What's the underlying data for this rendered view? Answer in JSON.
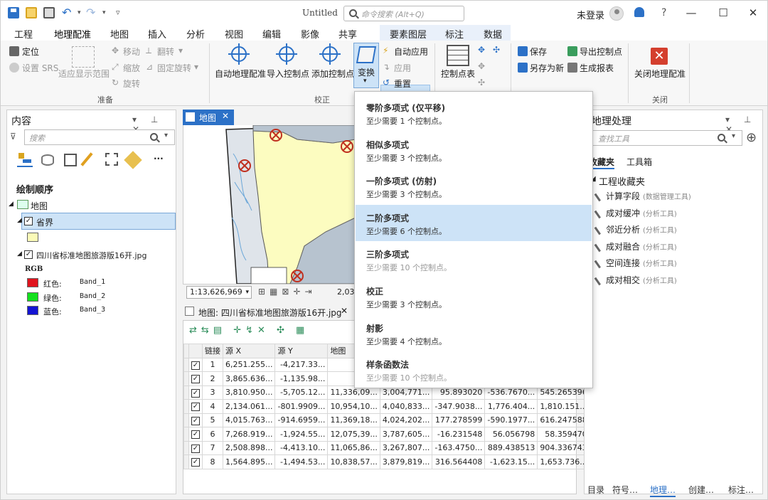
{
  "window": {
    "title": "Untitled",
    "command_search_placeholder": "命令搜索 (Alt+Q)",
    "login": "未登录",
    "help": "?",
    "controls": [
      "—",
      "☐",
      "✕"
    ]
  },
  "ribbon_tabs": [
    "工程",
    "地理配准",
    "地图",
    "插入",
    "分析",
    "视图",
    "编辑",
    "影像",
    "共享",
    "要素图层",
    "标注",
    "数据"
  ],
  "ribbon": {
    "prepare": {
      "locate": "定位",
      "move": "移动",
      "flip": "翻转",
      "set_srs": "设置 SRS",
      "fit_display": "适应显示范围",
      "scale": "缩放",
      "fixed_rotate": "固定旋转",
      "rotate": "旋转",
      "group_label": "准备"
    },
    "correct": {
      "auto_georef": "自动地理配准",
      "import_cp": "导入控制点",
      "add_cp": "添加控制点",
      "transform": "变换",
      "auto_apply": "自动应用",
      "apply": "应用",
      "reset": "重置",
      "group_label": "校正"
    },
    "cp_table": "控制点表",
    "save": {
      "save": "保存",
      "save_as_new": "另存为新",
      "export_cp": "导出控制点",
      "gen_report": "生成报表"
    },
    "close": {
      "close_georef": "关闭地理配准",
      "group_label": "关闭"
    }
  },
  "contents": {
    "title": "内容",
    "search_placeholder": "搜索",
    "draw_order": "绘制顺序",
    "map_node": "地图",
    "layer1": "省界",
    "layer2": "四川省标准地图旅游版16开.jpg",
    "rgb": "RGB",
    "bands": [
      {
        "label": "红色:",
        "band": "Band_1",
        "color": "#e0141e"
      },
      {
        "label": "绿色:",
        "band": "Band_2",
        "color": "#14e01e"
      },
      {
        "label": "蓝色:",
        "band": "Band_3",
        "color": "#1414d2"
      }
    ],
    "layer1_fill": "#fbfbb8"
  },
  "map": {
    "tab_label": "地图",
    "scale": "1:13,626,969",
    "coord_fragment": "2,03"
  },
  "table": {
    "tab_label": "地图: 四川省标准地图旅游版16开.jpg",
    "columns": [
      "链接",
      "源 X",
      "源 Y",
      "地图",
      "",
      "",
      "",
      ""
    ],
    "rows": [
      [
        "1",
        "6,251.255...",
        "-4,217.33...",
        "11,84",
        "",
        "",
        "",
        ""
      ],
      [
        "2",
        "3,865.636...",
        "-1,135.98...",
        "11,33",
        "",
        "",
        "",
        ""
      ],
      [
        "3",
        "3,810.950...",
        "-5,705.12...",
        "11,336,09...",
        "3,004,771...",
        "95.893020",
        "-536.7670...",
        "545.265396"
      ],
      [
        "4",
        "2,134.061...",
        "-801.9909...",
        "10,954,10...",
        "4,040,833...",
        "-347.9038...",
        "1,776.404...",
        "1,810.151..."
      ],
      [
        "5",
        "4,015.763...",
        "-914.6959...",
        "11,369,18...",
        "4,024,202...",
        "177.278599",
        "-590.1977...",
        "616.247588"
      ],
      [
        "6",
        "7,268.919...",
        "-1,924.55...",
        "12,075,39...",
        "3,787,605...",
        "-16.231548",
        "56.056798",
        "58.359470"
      ],
      [
        "7",
        "2,508.898...",
        "-4,413.10...",
        "11,065,86...",
        "3,267,807...",
        "-163.4750...",
        "889.438513",
        "904.336743"
      ],
      [
        "8",
        "1,564.895...",
        "-1,494.53...",
        "10,838,57...",
        "3,879,819...",
        "316.564408",
        "-1,623.15...",
        "1,653.736..."
      ]
    ]
  },
  "transform_menu": [
    {
      "title": "零阶多项式 (仅平移)",
      "desc": "至少需要 1 个控制点。",
      "enabled": true,
      "selected": false
    },
    {
      "title": "相似多项式",
      "desc": "至少需要 3 个控制点。",
      "enabled": true,
      "selected": false
    },
    {
      "title": "一阶多项式 (仿射)",
      "desc": "至少需要 3 个控制点。",
      "enabled": true,
      "selected": false
    },
    {
      "title": "二阶多项式",
      "desc": "至少需要 6 个控制点。",
      "enabled": true,
      "selected": true
    },
    {
      "title": "三阶多项式",
      "desc": "至少需要 10 个控制点。",
      "enabled": false,
      "selected": false
    },
    {
      "title": "校正",
      "desc": "至少需要 3 个控制点。",
      "enabled": true,
      "selected": false
    },
    {
      "title": "射影",
      "desc": "至少需要 4 个控制点。",
      "enabled": true,
      "selected": false
    },
    {
      "title": "样条函数法",
      "desc": "至少需要 10 个控制点。",
      "enabled": false,
      "selected": false
    }
  ],
  "geoprocessing": {
    "title": "地理处理",
    "search_placeholder": "查找工具",
    "tabs": [
      "收藏夹",
      "工具箱"
    ],
    "section": "工程收藏夹",
    "tools": [
      {
        "name": "计算字段",
        "category": "(数据管理工具)"
      },
      {
        "name": "成对缓冲",
        "category": "(分析工具)"
      },
      {
        "name": "邻近分析",
        "category": "(分析工具)"
      },
      {
        "name": "成对融合",
        "category": "(分析工具)"
      },
      {
        "name": "空间连接",
        "category": "(分析工具)"
      },
      {
        "name": "成对相交",
        "category": "(分析工具)"
      }
    ],
    "bottom_tabs": [
      "目录",
      "符号…",
      "地理…",
      "创建…",
      "标注…"
    ]
  },
  "accent": "#2c71c7"
}
